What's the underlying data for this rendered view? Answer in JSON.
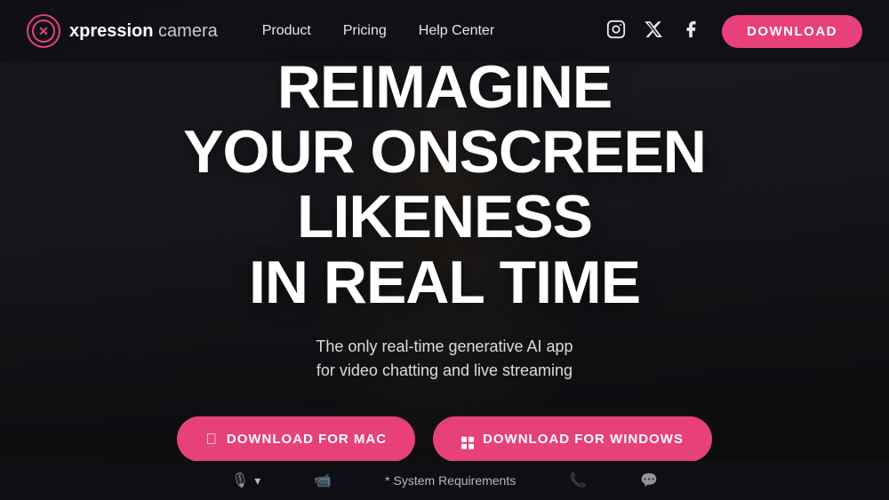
{
  "brand": {
    "logo_text_main": "xpression",
    "logo_text_suffix": " camera"
  },
  "nav": {
    "links": [
      {
        "id": "product",
        "label": "Product"
      },
      {
        "id": "pricing",
        "label": "Pricing"
      },
      {
        "id": "help",
        "label": "Help Center"
      }
    ],
    "download_label": "DOWNLOAD"
  },
  "social": {
    "icons": [
      "instagram",
      "twitter",
      "facebook"
    ]
  },
  "hero": {
    "title_line1": "REIMAGINE",
    "title_line2": "YOUR ONSCREEN LIKENESS",
    "title_line3": "IN REAL TIME",
    "subtitle_line1": "The only real-time generative AI app",
    "subtitle_line2": "for video chatting and live streaming",
    "cta_mac": "DOWNLOAD FOR MAC",
    "cta_windows": "DOWNLOAD FOR WINDOWS"
  },
  "bottom_bar": {
    "items": [
      {
        "id": "mic",
        "label": "",
        "icon": "mic"
      },
      {
        "id": "camera",
        "label": "",
        "icon": "camera"
      },
      {
        "id": "system_req",
        "label": "* System Requirements",
        "icon": ""
      },
      {
        "id": "phone",
        "label": "",
        "icon": "phone"
      },
      {
        "id": "chat",
        "label": "",
        "icon": "chat"
      }
    ]
  }
}
